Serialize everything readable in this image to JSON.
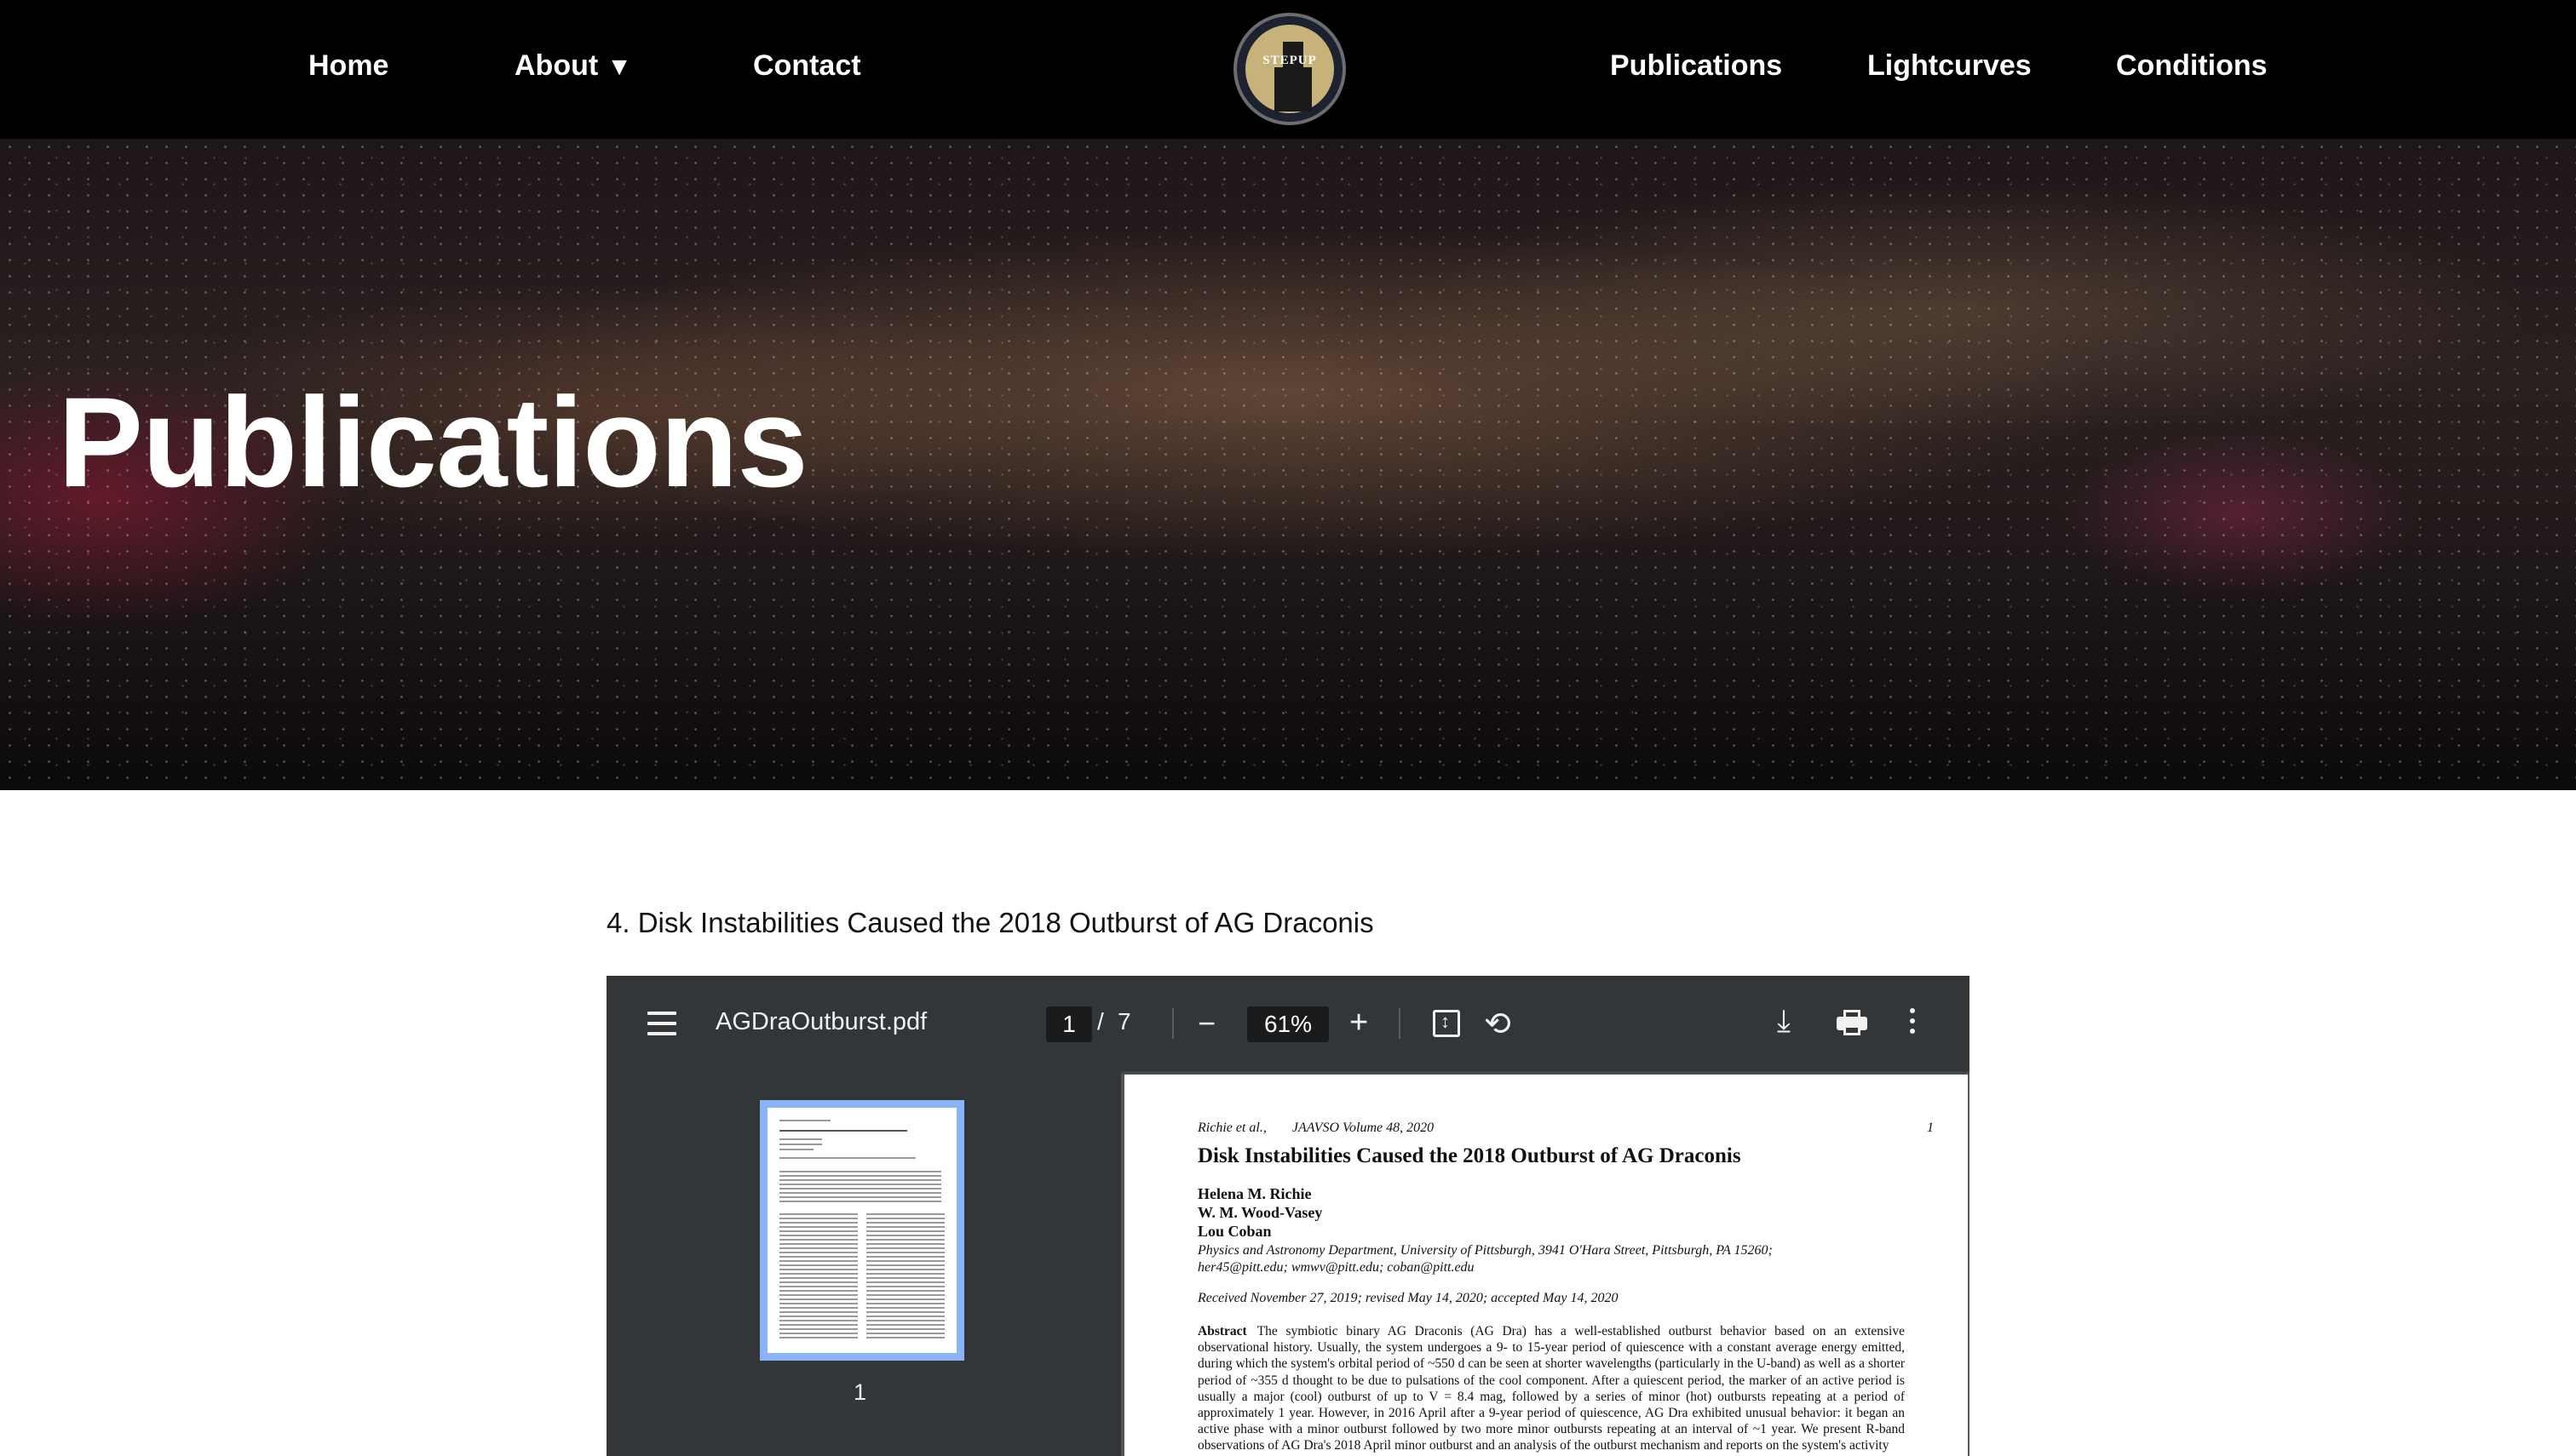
{
  "nav": {
    "home": "Home",
    "about": "About",
    "about_arrow": "▼",
    "contact": "Contact",
    "logo_text": "STEPUP",
    "publications": "Publications",
    "lightcurves": "Lightcurves",
    "conditions": "Conditions"
  },
  "hero": {
    "title": "Publications"
  },
  "publication": {
    "heading": "4. Disk Instabilities Caused the 2018 Outburst of AG Draconis"
  },
  "viewer": {
    "filename": "AGDraOutburst.pdf",
    "current_page": "1",
    "separator": "/",
    "total_pages": "7",
    "zoom": "61%",
    "zoom_out_symbol": "−",
    "zoom_in_symbol": "+",
    "download_symbol": "⤓",
    "rotate_symbol": "⟲",
    "thumbnail_label": "1"
  },
  "paper": {
    "header_left": "Richie et al.,",
    "header_journal": "JAAVSO Volume 48, 2020",
    "page_number": "1",
    "title": "Disk Instabilities Caused the 2018 Outburst of AG Draconis",
    "authors": [
      "Helena M. Richie",
      "W. M. Wood-Vasey",
      "Lou Coban"
    ],
    "affiliation_1": "Physics and Astronomy Department, University of Pittsburgh, 3941 O'Hara Street, Pittsburgh, PA 15260;",
    "affiliation_2": "her45@pitt.edu; wmwv@pitt.edu; coban@pitt.edu",
    "received": "Received November 27, 2019; revised May 14, 2020; accepted May 14, 2020",
    "abstract_label": "Abstract",
    "abstract_text": "The symbiotic binary AG Draconis (AG Dra) has a well-established outburst behavior based on an extensive observational history. Usually, the system undergoes a 9- to 15-year period of quiescence with a constant average energy emitted, during which the system's orbital period of ~550 d can be seen at shorter wavelengths (particularly in the U-band) as well as a shorter period of ~355 d thought to be due to pulsations of the cool component. After a quiescent period, the marker of an active period is usually a major (cool) outburst of up to V = 8.4 mag, followed by a series of minor (hot) outbursts repeating at a period of approximately 1 year. However, in 2016 April after a 9-year period of quiescence, AG Dra exhibited unusual behavior: it began an active phase with a minor outburst followed by two more minor outbursts repeating at an interval of ~1 year. We present R-band observations of AG Dra's 2018 April minor outburst and an analysis of the outburst mechanism and reports on the system's activity"
  },
  "colors": {
    "nav_bg": "#000000",
    "viewer_toolbar": "#323639",
    "thumbnail_highlight": "#8ab4f8"
  }
}
